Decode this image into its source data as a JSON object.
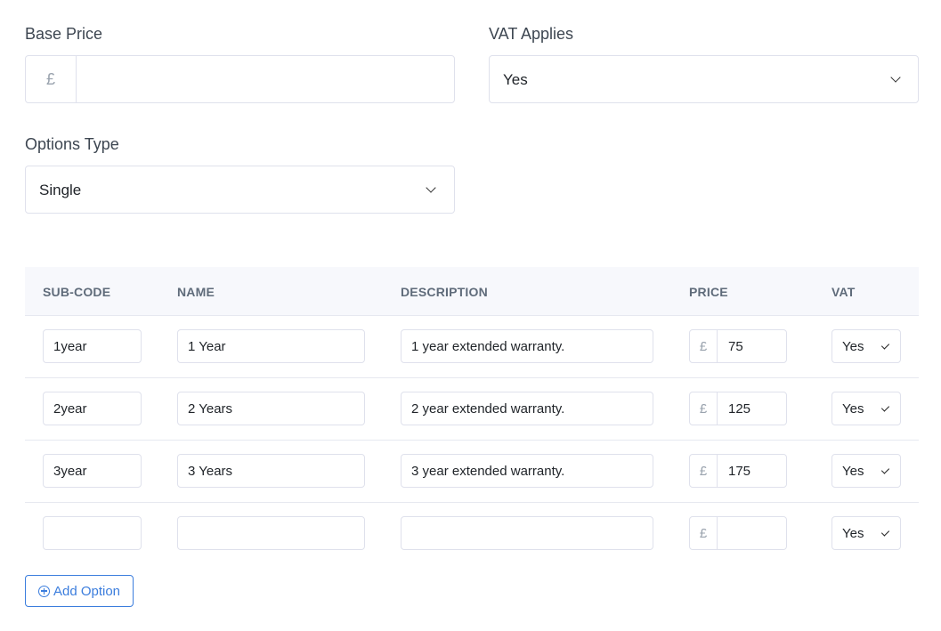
{
  "form": {
    "base_price": {
      "label": "Base Price",
      "currency_symbol": "£",
      "value": ""
    },
    "vat_applies": {
      "label": "VAT Applies",
      "selected": "Yes"
    },
    "options_type": {
      "label": "Options Type",
      "selected": "Single"
    }
  },
  "options_table": {
    "headers": [
      "SUB-CODE",
      "NAME",
      "DESCRIPTION",
      "PRICE",
      "VAT"
    ],
    "currency_symbol": "£",
    "rows": [
      {
        "sub_code": "1year",
        "name": "1 Year",
        "description": "1 year extended warranty.",
        "price": "75",
        "vat": "Yes"
      },
      {
        "sub_code": "2year",
        "name": "2 Years",
        "description": "2 year extended warranty.",
        "price": "125",
        "vat": "Yes"
      },
      {
        "sub_code": "3year",
        "name": "3 Years",
        "description": "3 year extended warranty.",
        "price": "175",
        "vat": "Yes"
      },
      {
        "sub_code": "",
        "name": "",
        "description": "",
        "price": "",
        "vat": "Yes"
      }
    ]
  },
  "actions": {
    "add_option_label": "Add Option",
    "add_option_icon": "plus-circle-icon"
  }
}
